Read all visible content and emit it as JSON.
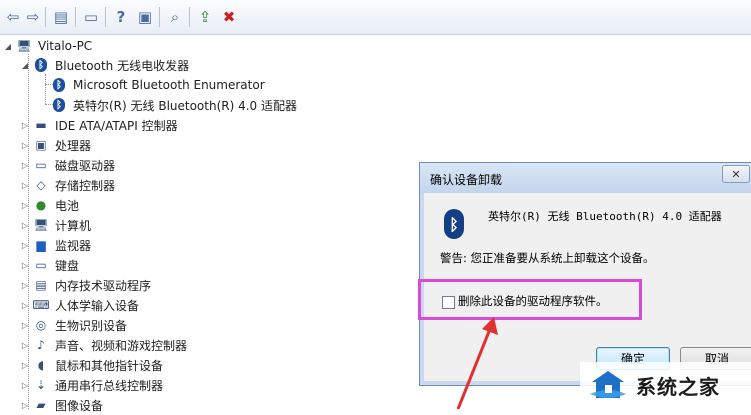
{
  "toolbar": {
    "buttons": [
      {
        "icon": "back-arrow-icon",
        "glyph": "⇦"
      },
      {
        "icon": "forward-arrow-icon",
        "glyph": "⇨"
      },
      {
        "icon": "show-hide-console-tree-icon",
        "glyph": "▤"
      },
      {
        "icon": "properties-icon",
        "glyph": "▭"
      },
      {
        "icon": "help-icon",
        "glyph": "?"
      },
      {
        "icon": "action-pane-icon",
        "glyph": "▣"
      },
      {
        "icon": "scan-hardware-icon",
        "glyph": "⌕"
      },
      {
        "icon": "update-driver-icon",
        "glyph": "⇪"
      },
      {
        "icon": "uninstall-device-icon",
        "glyph": "✖"
      }
    ]
  },
  "tree": {
    "root": "Vitalo-PC",
    "expanded_category": "Bluetooth 无线电收发器",
    "children": [
      "Microsoft Bluetooth Enumerator",
      "英特尔(R) 无线 Bluetooth(R) 4.0 适配器"
    ],
    "categories": [
      {
        "label": "IDE ATA/ATAPI 控制器",
        "icon": "ide-controller-icon"
      },
      {
        "label": "处理器",
        "icon": "processor-icon"
      },
      {
        "label": "磁盘驱动器",
        "icon": "disk-drive-icon"
      },
      {
        "label": "存储控制器",
        "icon": "storage-controller-icon"
      },
      {
        "label": "电池",
        "icon": "battery-icon"
      },
      {
        "label": "计算机",
        "icon": "computer-icon"
      },
      {
        "label": "监视器",
        "icon": "monitor-icon"
      },
      {
        "label": "键盘",
        "icon": "keyboard-icon"
      },
      {
        "label": "内存技术驱动程序",
        "icon": "memory-technology-icon"
      },
      {
        "label": "人体学输入设备",
        "icon": "hid-icon"
      },
      {
        "label": "生物识别设备",
        "icon": "biometric-icon"
      },
      {
        "label": "声音、视频和游戏控制器",
        "icon": "sound-icon"
      },
      {
        "label": "鼠标和其他指针设备",
        "icon": "mouse-icon"
      },
      {
        "label": "通用串行总线控制器",
        "icon": "usb-icon"
      },
      {
        "label": "图像设备",
        "icon": "imaging-device-icon"
      }
    ]
  },
  "dialog": {
    "title": "确认设备卸载",
    "close_label": "✕",
    "device_name": "英特尔(R) 无线 Bluetooth(R) 4.0 适配器",
    "warning": "警告: 您正准备要从系统上卸载这个设备。",
    "checkbox_label": "删除此设备的驱动程序软件。",
    "checkbox_checked": false,
    "ok_label": "确定",
    "cancel_label": "取消"
  },
  "annotation": {
    "highlight_color": "#d84ad8",
    "arrow_color": "#e03030"
  },
  "watermark": {
    "text": "系统之家"
  }
}
